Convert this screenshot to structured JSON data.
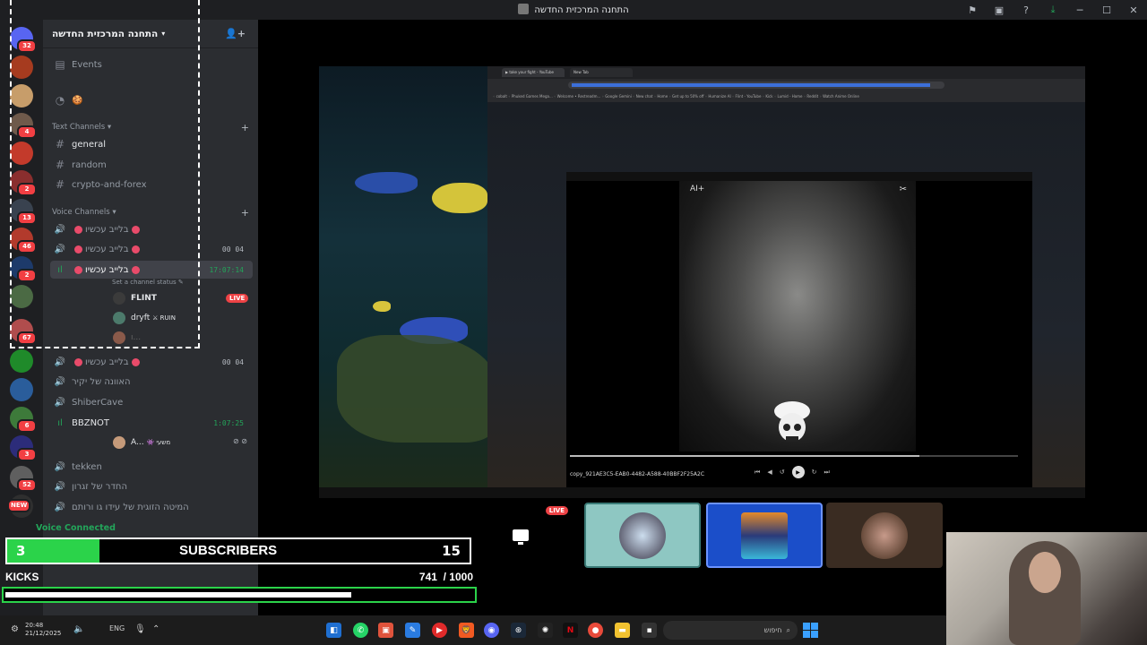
{
  "window": {
    "title": "התחנה המרכזית החדשה"
  },
  "server": {
    "name": "התחנה המרכזית החדשה",
    "events_label": "Events",
    "text_category": "Text Channels",
    "voice_category": "Voice Channels",
    "text_channels": [
      {
        "name": "general"
      },
      {
        "name": "random"
      },
      {
        "name": "crypto-and-forex"
      }
    ],
    "voice_channels": [
      {
        "name": "בלייב עכשיו",
        "timer": ""
      },
      {
        "name": "בלייב עכשיו",
        "timer": "00 04"
      },
      {
        "name": "בלייב עכשיו",
        "timer": "17:07:14"
      },
      {
        "name": "בלייב עכשיו",
        "timer": "00 04"
      },
      {
        "name": "האוונה של יקיר",
        "timer": ""
      },
      {
        "name": "ShiberCave",
        "timer": ""
      },
      {
        "name": "BBZNOT",
        "timer": "1:07:25"
      },
      {
        "name": "tekken",
        "timer": ""
      },
      {
        "name": "החדר של זגרון",
        "timer": ""
      },
      {
        "name": "המיטה הזוגית של עידו גו ורותם",
        "timer": ""
      }
    ],
    "set_status": "Set a channel status",
    "members": [
      {
        "name": "FLINT"
      },
      {
        "name": "dryft",
        "tag": "RUIN"
      },
      {
        "name": "A...",
        "tag": "משעי"
      }
    ],
    "live_label": "LIVE",
    "voice_connected": "Voice Connected"
  },
  "rail": {
    "badges": [
      "32",
      "4",
      "2",
      "13",
      "46",
      "2",
      "67",
      "6",
      "3",
      "52",
      "NEW"
    ]
  },
  "overlay": {
    "subscribers_count": "3",
    "subscribers_label": "SUBSCRIBERS",
    "subscribers_goal": "15",
    "subscribers_progress": 0.2,
    "kicks_label": "KICKS",
    "kicks_count": "741",
    "kicks_goal": "/ 1000",
    "kicks_progress": 0.741
  },
  "stream": {
    "ai_tag": "AI+",
    "file_name": "copy_921AE3C5-EAB0-4482-A588-40BBF2F25A2C",
    "progress": 0.78
  },
  "tiles": {
    "live_label": "LIVE"
  },
  "taskbar": {
    "time": "20:48",
    "date": "21/12/2025",
    "lang": "ENG",
    "search_placeholder": "חיפוש"
  },
  "colors": {
    "accent_green": "#2bd34a",
    "live_red": "#ed4245",
    "sidebar_bg": "#2b2d31"
  }
}
